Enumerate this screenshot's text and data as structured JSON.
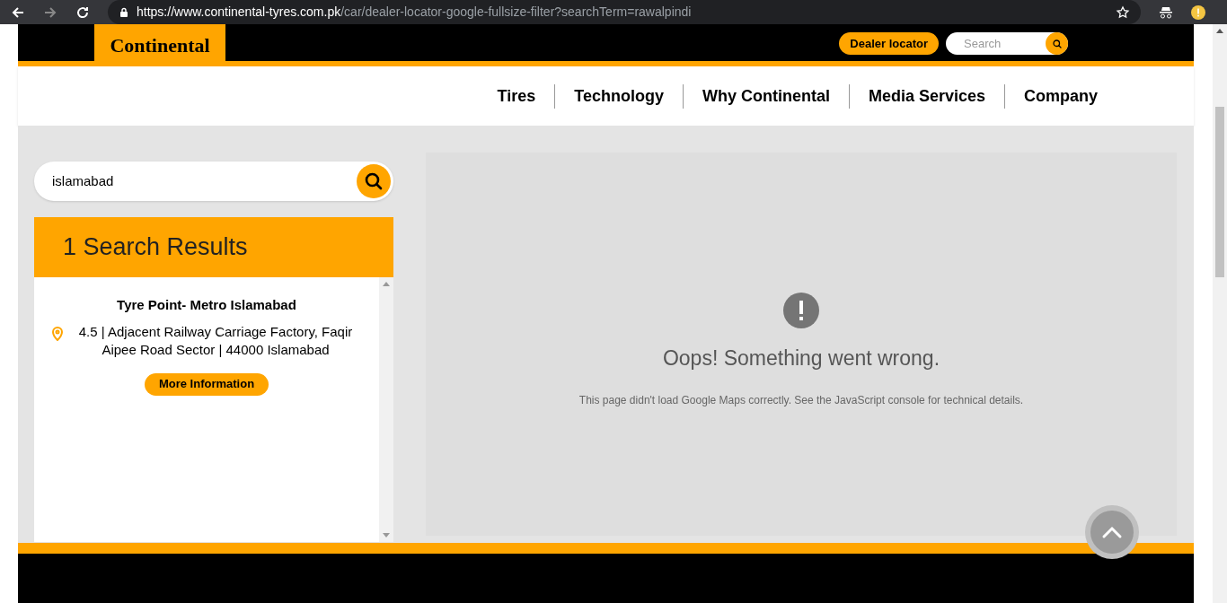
{
  "browser": {
    "url_host": "https://www.continental-tyres.com.pk",
    "url_path": "/car/dealer-locator-google-fullsize-filter?searchTerm=rawalpindi"
  },
  "header": {
    "logo": "Continental",
    "dealer_button": "Dealer locator",
    "search": {
      "placeholder": "Search"
    }
  },
  "nav": [
    "Tires",
    "Technology",
    "Why Continental",
    "Media Services",
    "Company"
  ],
  "locator": {
    "search_value": "islamabad",
    "results_title": "1 Search Results",
    "results": [
      {
        "name": "Tyre Point- Metro Islamabad",
        "address": "4.5 | Adjacent Railway Carriage Factory, Faqir Aipee Road Sector | 44000 Islamabad",
        "button": "More Information"
      }
    ]
  },
  "map_error": {
    "title": "Oops! Something went wrong.",
    "message": "This page didn't load Google Maps correctly. See the JavaScript console for technical details."
  }
}
